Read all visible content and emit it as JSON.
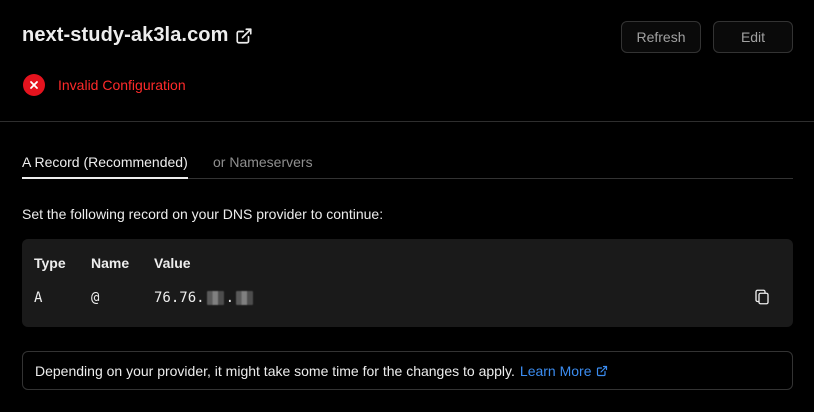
{
  "header": {
    "domain": "next-study-ak3la.com",
    "refresh_label": "Refresh",
    "edit_label": "Edit"
  },
  "status": {
    "text": "Invalid Configuration",
    "color": "#e5131e"
  },
  "tabs": [
    {
      "label": "A Record (Recommended)",
      "active": true
    },
    {
      "label": "or Nameservers",
      "active": false
    }
  ],
  "instructions": "Set the following record on your DNS provider to continue:",
  "record": {
    "headers": {
      "type": "Type",
      "name": "Name",
      "value": "Value"
    },
    "row": {
      "type": "A",
      "name": "@",
      "value_prefix": "76.76.",
      "value_sep": "."
    }
  },
  "note": {
    "text": "Depending on your provider, it might take some time for the changes to apply.",
    "link_label": "Learn More",
    "link_color": "#3b8cf0"
  }
}
